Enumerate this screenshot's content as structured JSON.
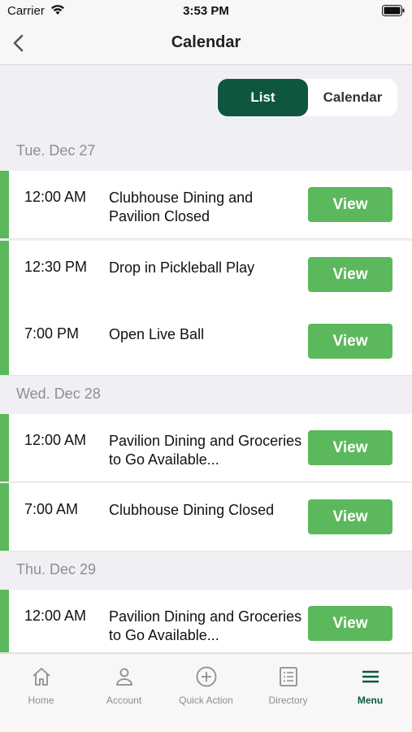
{
  "status": {
    "carrier": "Carrier",
    "time": "3:53 PM"
  },
  "nav": {
    "title": "Calendar"
  },
  "segment": {
    "list_label": "List",
    "calendar_label": "Calendar",
    "selected": "List"
  },
  "days": [
    {
      "label": "Tue. Dec 27",
      "events": [
        {
          "time": "12:00 AM",
          "title": "Clubhouse Dining and Pavilion Closed",
          "button": "View"
        },
        {
          "time": "12:30 PM",
          "title": "Drop in Pickleball Play",
          "button": "View"
        },
        {
          "time": "7:00 PM",
          "title": "Open Live Ball",
          "button": "View"
        }
      ]
    },
    {
      "label": "Wed. Dec 28",
      "events": [
        {
          "time": "12:00 AM",
          "title": "Pavilion Dining and Groceries to Go Available...",
          "button": "View"
        },
        {
          "time": "7:00 AM",
          "title": "Clubhouse Dining Closed",
          "button": "View"
        }
      ]
    },
    {
      "label": "Thu. Dec 29",
      "events": [
        {
          "time": "12:00 AM",
          "title": "Pavilion Dining and Groceries to Go Available...",
          "button": "View"
        }
      ]
    }
  ],
  "tabs": [
    {
      "label": "Home",
      "icon": "home-icon"
    },
    {
      "label": "Account",
      "icon": "person-icon"
    },
    {
      "label": "Quick Action",
      "icon": "plus-circle-icon"
    },
    {
      "label": "Directory",
      "icon": "directory-icon"
    },
    {
      "label": "Menu",
      "icon": "menu-icon",
      "active": true
    }
  ],
  "colors": {
    "accent": "#5cb85c",
    "brand_dark": "#0f5640",
    "header_text": "#8e8e93"
  }
}
